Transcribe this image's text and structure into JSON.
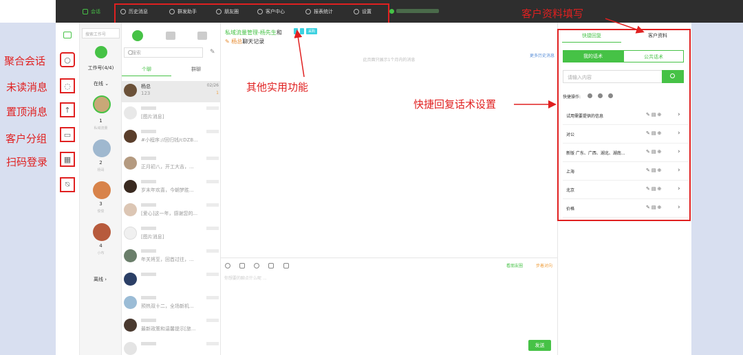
{
  "topnav": {
    "items": [
      {
        "label": "会话"
      },
      {
        "label": "历史消息"
      },
      {
        "label": "群发助手"
      },
      {
        "label": "朋友圈"
      },
      {
        "label": "客户中心"
      },
      {
        "label": "报表统计"
      },
      {
        "label": "设置"
      }
    ]
  },
  "annotations": {
    "aggregate": "聚合会话",
    "unread": "未读消息",
    "pinned": "置顶消息",
    "groups": "客户分组",
    "qr_login": "扫码登录",
    "other_tools": "其他实用功能",
    "quick_reply": "快捷回复话术设置",
    "customer_info": "客户资料填写"
  },
  "accounts": {
    "search_placeholder": "搜索工作号",
    "title": "工作号(4/4)",
    "online_label": "在线",
    "offline_label": "离线",
    "list": [
      {
        "num": "1",
        "name": "私域流量"
      },
      {
        "num": "2",
        "name": "杨哥"
      },
      {
        "num": "3",
        "name": "俊俊"
      },
      {
        "num": "4",
        "name": "小布"
      }
    ]
  },
  "chatlist": {
    "search_placeholder": "搜索",
    "tab_private": "个聊",
    "tab_group": "群聊",
    "items": [
      {
        "name": "杨总",
        "preview": "123",
        "time": "02/26",
        "badge": "1"
      },
      {
        "name": "",
        "preview": "[图片消息]"
      },
      {
        "name": "",
        "preview": "#小程序://回归钱/cDZB..."
      },
      {
        "name": "",
        "preview": "正月初八，开工大吉，..."
      },
      {
        "name": "",
        "preview": "岁末年欢喜，今朝梦胜..."
      },
      {
        "name": "",
        "preview": "[爱心]这一年，感谢您的..."
      },
      {
        "name": "",
        "preview": "[图片消息]"
      },
      {
        "name": "",
        "preview": "年关将至，回首过往，..."
      },
      {
        "name": "",
        "preview": ""
      },
      {
        "name": "",
        "preview": "预热双十二，全场新机..."
      },
      {
        "name": "",
        "preview": "最新政策和温馨提示[旅..."
      }
    ]
  },
  "chat": {
    "header_green": "私域流量管理-杨先生",
    "header_and": "和",
    "tag": "采购",
    "sub_orange": "杨总",
    "sub_rest": "聊天记录",
    "more_history": "更多历史消息",
    "only_month": "此页面只展示1个月内的消息",
    "moments": "看朋友圈",
    "moments2": "步着对向",
    "input_placeholder": "你想要的聊点什么呢 ...",
    "send": "发送"
  },
  "rightpanel": {
    "tab_quick": "快捷回复",
    "tab_info": "客户资料",
    "seg_mine": "我的话术",
    "seg_public": "公共话术",
    "search_placeholder": "请输入内容",
    "quick_ops": "快捷操作:",
    "rows": [
      {
        "label": "试用需要提供的信息"
      },
      {
        "label": "对公"
      },
      {
        "label": "新版 广东、广西、湖北、湖南..."
      },
      {
        "label": "上海"
      },
      {
        "label": "北京"
      },
      {
        "label": "价格"
      }
    ]
  }
}
